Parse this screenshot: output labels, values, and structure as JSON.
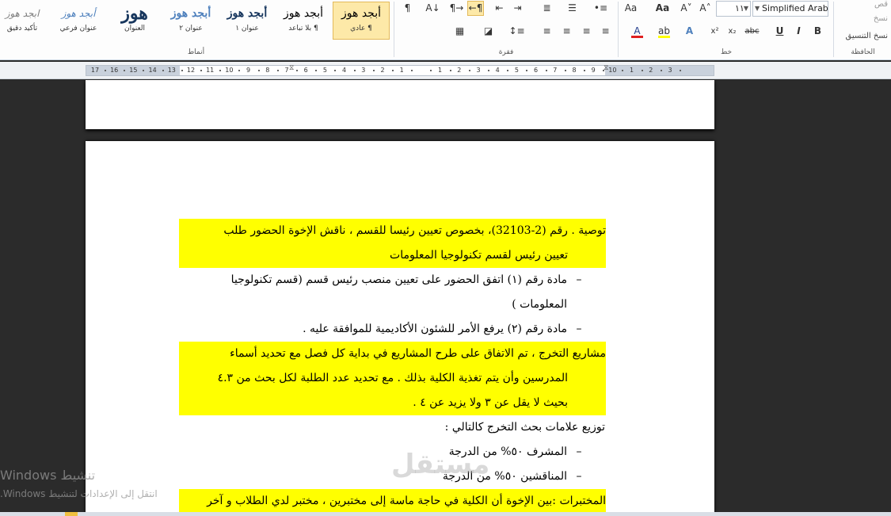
{
  "ribbon": {
    "groups": {
      "styles": "أنماط",
      "paragraph": "فقرة",
      "font": "خط",
      "clipboard": "الحافظة"
    },
    "styles_gallery": [
      {
        "sample": "أبجد هوز",
        "name": "¶ عادي",
        "active": true,
        "color": "#000000"
      },
      {
        "sample": "أبجد هوز",
        "name": "¶ بلا تباعد",
        "active": false,
        "color": "#000000"
      },
      {
        "sample": "أبجد هوز",
        "name": "عنوان ١",
        "active": false,
        "color": "#17365d"
      },
      {
        "sample": "أبجد هوز",
        "name": "عنوان ٢",
        "active": false,
        "color": "#4f81bd"
      },
      {
        "sample": "هوز",
        "name": "العنوان",
        "active": false,
        "color": "#17365d"
      },
      {
        "sample": "أبجد هوز",
        "name": "عنوان فرعي",
        "active": false,
        "color": "#4f81bd"
      },
      {
        "sample": "ابجد هوز",
        "name": "تأكيد دقيق",
        "active": false,
        "color": "#7f7f7f"
      }
    ],
    "font_name": "Simplified Arabic",
    "font_size": "١١",
    "clipboard_items": [
      "قص",
      "نسخ",
      "نسخ التنسيق"
    ],
    "colors": {
      "highlight": "#ffff00",
      "font_red": "#e02020",
      "active_bg": "#fde9a8"
    }
  },
  "ruler": {
    "numbers": [
      "17",
      "16",
      "15",
      "14",
      "13",
      "12",
      "11",
      "10",
      "9",
      "8",
      "7",
      "6",
      "5",
      "4",
      "3",
      "2",
      "1",
      " ",
      "1",
      "2",
      "3",
      "4",
      "5",
      "6",
      "7",
      "8",
      "9",
      "10",
      "1",
      "2",
      "3"
    ]
  },
  "document": {
    "blocks": [
      {
        "type": "para",
        "highlight": true,
        "lines": [
          "توصية . رقم (2-32103)، بخصوص تعيين رئيسا للقسم ، ناقش الإخوة الحضور طلب",
          "تعيين  رئيس لقسم تكنولوجيا المعلومات"
        ]
      },
      {
        "type": "bullet",
        "highlight": false,
        "lines": [
          "مادة رقم (١) اتفق الحضور على تعيين منصب رئيس قسم (قسم تكنولوجيا",
          "المعلومات )"
        ]
      },
      {
        "type": "bullet",
        "highlight": false,
        "lines": [
          "مادة رقم (٢) يرفع الأمر للشئون الأكاديمية للموافقة عليه ."
        ]
      },
      {
        "type": "para",
        "highlight": true,
        "lines": [
          "مشاريع التخرج ، تم الاتفاق على طرح المشاريع في بداية كل فصل مع تحديد أسماء",
          "المدرسين وأن يتم تغذية الكلية بذلك . مع تحديد عدد الطلبة لكل بحث من ٤.٣",
          "بحيث لا يقل عن ٣ ولا يزيد عن ٤ ."
        ]
      },
      {
        "type": "para",
        "highlight": false,
        "lines": [
          "توزيع علامات بحث التخرج كالتالي :"
        ]
      },
      {
        "type": "bullet",
        "highlight": false,
        "lines": [
          "المشرف ٥٠% من الدرجة"
        ]
      },
      {
        "type": "bullet",
        "highlight": false,
        "lines": [
          "المناقشين ٥٠% من الدرجة"
        ]
      },
      {
        "type": "para",
        "highlight": true,
        "lines": [
          "المختبرات :بين الإخوة أن الكلية في حاجة ماسة إلى مختبرين ، مختبر لدي الطلاب و آخر"
        ]
      }
    ]
  },
  "overlay": {
    "windows_line1": "تنشيط Windows",
    "windows_line2": "انتقل إلى الإعدادات لتنشيط Windows.",
    "logo_text": "مستقل"
  }
}
